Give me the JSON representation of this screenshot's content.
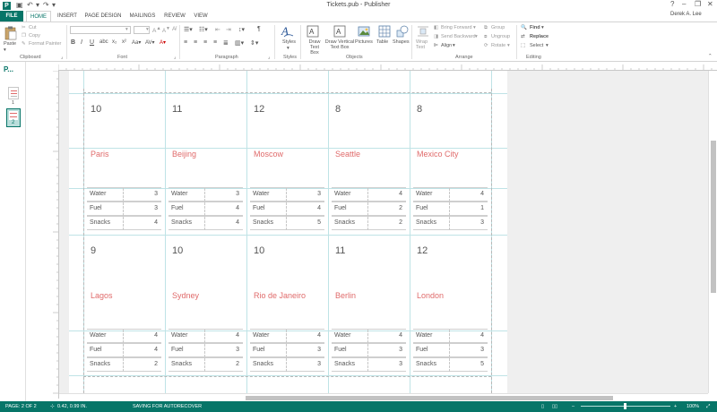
{
  "window": {
    "title": "Tickets.pub - Publisher",
    "app_icon": "P",
    "controls": {
      "help": "?",
      "minimize": "–",
      "restore": "❐",
      "close": "✕"
    }
  },
  "tabs": [
    "FILE",
    "HOME",
    "INSERT",
    "PAGE DESIGN",
    "MAILINGS",
    "REVIEW",
    "VIEW"
  ],
  "active_tab": "HOME",
  "user_name": "Derek A. Lee",
  "ribbon": {
    "clipboard": {
      "paste": "Paste",
      "cut": "Cut",
      "copy": "Copy",
      "format_painter": "Format Painter",
      "label": "Clipboard"
    },
    "font": {
      "label": "Font"
    },
    "paragraph": {
      "label": "Paragraph"
    },
    "styles": {
      "button": "Styles",
      "label": "Styles"
    },
    "objects": {
      "draw_text_box": "Draw Text Box",
      "draw_vertical_text_box": "Draw Vertical Text Box",
      "pictures": "Pictures",
      "table": "Table",
      "shapes": "Shapes",
      "label": "Objects"
    },
    "arrange": {
      "wrap_text": "Wrap Text",
      "bring_forward": "Bring Forward",
      "send_backward": "Send Backward",
      "align": "Align",
      "group": "Group",
      "ungroup": "Ungroup",
      "rotate": "Rotate",
      "label": "Arrange"
    },
    "editing": {
      "find": "Find",
      "replace": "Replace",
      "select": "Select",
      "label": "Editing"
    }
  },
  "pages_pane": {
    "title": "P...",
    "pages": [
      "1",
      "2"
    ],
    "selected_page": "2"
  },
  "tickets": [
    {
      "num": "10",
      "city": "Paris",
      "water": "3",
      "fuel": "3",
      "snacks": "4"
    },
    {
      "num": "11",
      "city": "Beijing",
      "water": "3",
      "fuel": "4",
      "snacks": "4"
    },
    {
      "num": "12",
      "city": "Moscow",
      "water": "3",
      "fuel": "4",
      "snacks": "5"
    },
    {
      "num": "8",
      "city": "Seattle",
      "water": "4",
      "fuel": "2",
      "snacks": "2"
    },
    {
      "num": "8",
      "city": "Mexico City",
      "water": "4",
      "fuel": "1",
      "snacks": "3"
    },
    {
      "num": "9",
      "city": "Lagos",
      "water": "4",
      "fuel": "4",
      "snacks": "2"
    },
    {
      "num": "10",
      "city": "Sydney",
      "water": "4",
      "fuel": "3",
      "snacks": "2"
    },
    {
      "num": "10",
      "city": "Rio de Janeiro",
      "water": "4",
      "fuel": "3",
      "snacks": "3"
    },
    {
      "num": "11",
      "city": "Berlin",
      "water": "4",
      "fuel": "3",
      "snacks": "3"
    },
    {
      "num": "12",
      "city": "London",
      "water": "4",
      "fuel": "3",
      "snacks": "5"
    }
  ],
  "row_labels": {
    "water": "Water",
    "fuel": "Fuel",
    "snacks": "Snacks"
  },
  "status": {
    "page": "PAGE: 2 OF 2",
    "position": "0.42, 0.99 IN.",
    "message": "SAVING FOR AUTORECOVER",
    "zoom": "100%"
  },
  "colors": {
    "accent": "#077568",
    "city_text": "#e06b6b"
  }
}
